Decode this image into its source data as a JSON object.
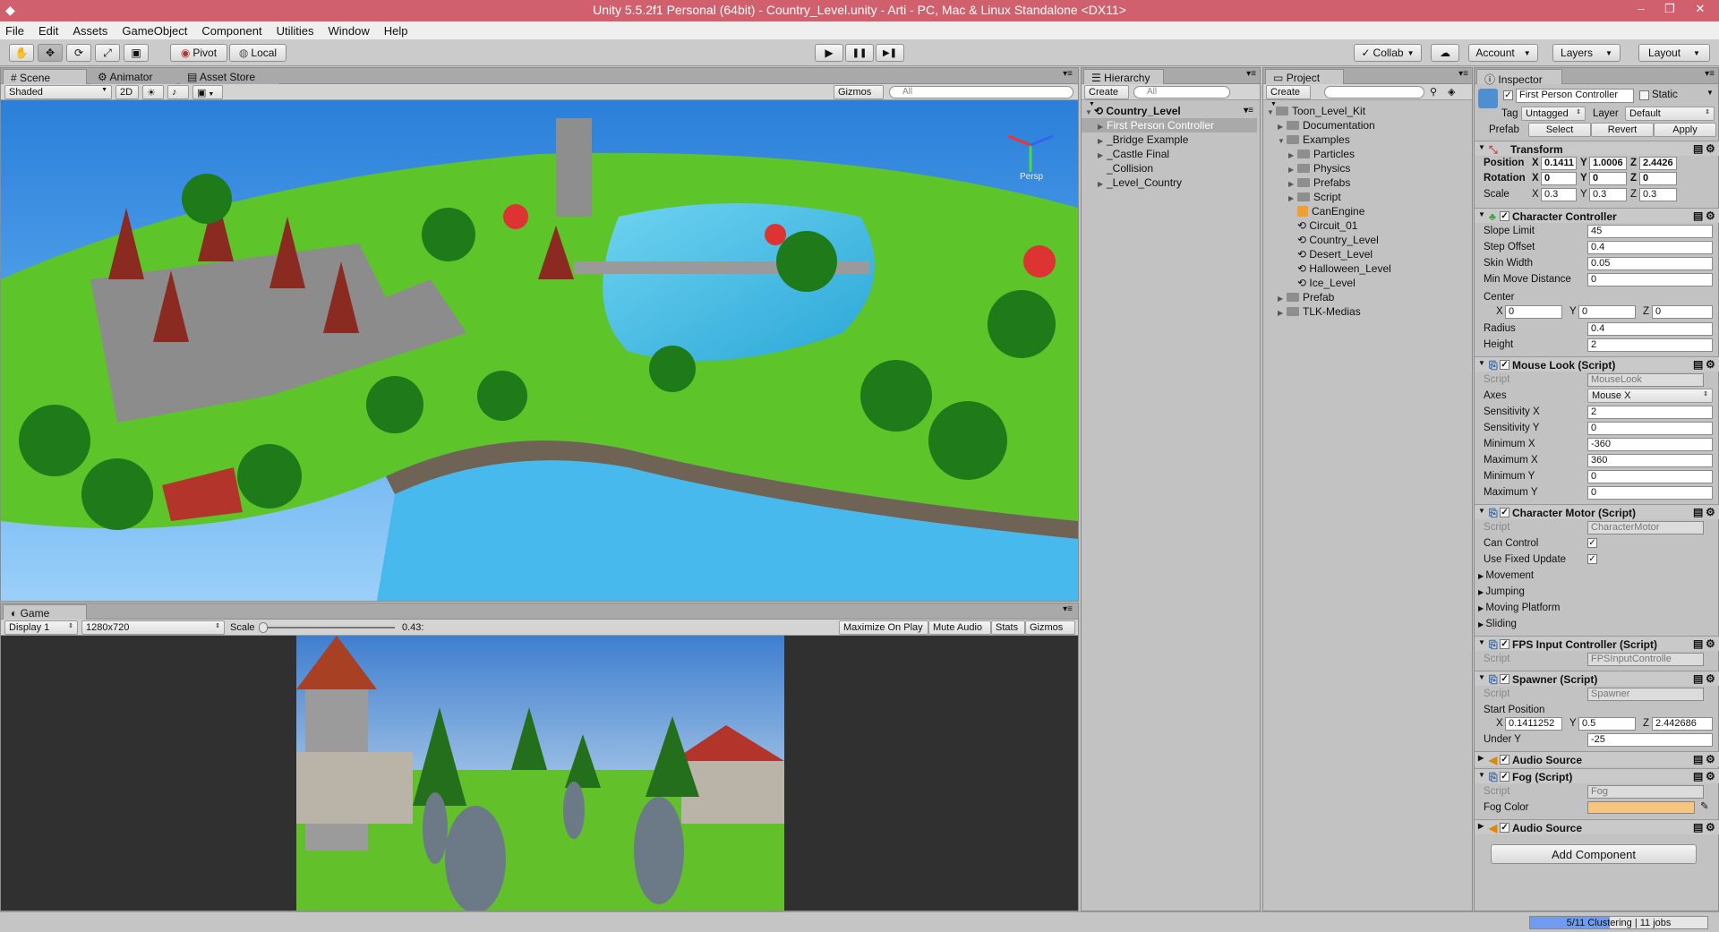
{
  "titlebar": {
    "title": "Unity 5.5.2f1 Personal (64bit) - Country_Level.unity - Arti - PC, Mac & Linux Standalone <DX11>",
    "min": "‒",
    "max": "❐",
    "close": "✕"
  },
  "menu": [
    "File",
    "Edit",
    "Assets",
    "GameObject",
    "Component",
    "Utilities",
    "Window",
    "Help"
  ],
  "toolbar": {
    "pivot": "Pivot",
    "local": "Local",
    "collab": "Collab",
    "account": "Account",
    "layers": "Layers",
    "layout": "Layout",
    "play": "▶",
    "pause": "❚❚",
    "step": "▶❚"
  },
  "scene": {
    "tabs": [
      "Scene",
      "Animator",
      "Asset Store"
    ],
    "shaded": "Shaded",
    "mode2d": "2D",
    "gizmos": "Gizmos",
    "search": "All",
    "persp": "Persp"
  },
  "game": {
    "tab": "Game",
    "display": "Display 1",
    "resolution": "1280x720",
    "scale_label": "Scale",
    "scale_value": "0.43:",
    "scale_fraction": 0.43,
    "buttons": [
      "Maximize On Play",
      "Mute Audio",
      "Stats",
      "Gizmos"
    ]
  },
  "hierarchy": {
    "tab": "Hierarchy",
    "create": "Create",
    "search": "All",
    "scene": "Country_Level",
    "items": [
      "First Person Controller",
      "_Bridge Example",
      "_Castle Final",
      "_Collision",
      "_Level_Country"
    ]
  },
  "project": {
    "tab": "Project",
    "create": "Create",
    "items": [
      {
        "label": "Toon_Level_Kit",
        "indent": 0,
        "type": "folder",
        "open": true
      },
      {
        "label": "Documentation",
        "indent": 1,
        "type": "folder"
      },
      {
        "label": "Examples",
        "indent": 1,
        "type": "folder",
        "open": true
      },
      {
        "label": "Particles",
        "indent": 2,
        "type": "folder"
      },
      {
        "label": "Physics",
        "indent": 2,
        "type": "folder"
      },
      {
        "label": "Prefabs",
        "indent": 2,
        "type": "folder"
      },
      {
        "label": "Script",
        "indent": 2,
        "type": "folder"
      },
      {
        "label": "CanEngine",
        "indent": 2,
        "type": "asset"
      },
      {
        "label": "Circuit_01",
        "indent": 2,
        "type": "scene"
      },
      {
        "label": "Country_Level",
        "indent": 2,
        "type": "scene"
      },
      {
        "label": "Desert_Level",
        "indent": 2,
        "type": "scene"
      },
      {
        "label": "Halloween_Level",
        "indent": 2,
        "type": "scene"
      },
      {
        "label": "Ice_Level",
        "indent": 2,
        "type": "scene"
      },
      {
        "label": "Prefab",
        "indent": 1,
        "type": "folder"
      },
      {
        "label": "TLK-Medias",
        "indent": 1,
        "type": "folder"
      }
    ]
  },
  "inspector": {
    "tab": "Inspector",
    "name": "First Person Controller",
    "static": "Static",
    "tag_label": "Tag",
    "tag": "Untagged",
    "layer_label": "Layer",
    "layer": "Default",
    "prefab_label": "Prefab",
    "prefab_buttons": [
      "Select",
      "Revert",
      "Apply"
    ],
    "transform": {
      "title": "Transform",
      "position": "Position",
      "rotation": "Rotation",
      "scale": "Scale",
      "pos": [
        "0.1411",
        "1.0006",
        "2.4426"
      ],
      "rot": [
        "0",
        "0",
        "0"
      ],
      "scl": [
        "0.3",
        "0.3",
        "0.3"
      ]
    },
    "cc": {
      "title": "Character Controller",
      "slope_label": "Slope Limit",
      "slope": "45",
      "step_label": "Step Offset",
      "step": "0.4",
      "skin_label": "Skin Width",
      "skin": "0.05",
      "minmove_label": "Min Move Distance",
      "minmove": "0",
      "center_label": "Center",
      "center": [
        "0",
        "0",
        "0"
      ],
      "radius_label": "Radius",
      "radius": "0.4",
      "height_label": "Height",
      "height": "2"
    },
    "mouselook": {
      "title": "Mouse Look (Script)",
      "script_label": "Script",
      "script": "MouseLook",
      "axes_label": "Axes",
      "axes": "Mouse X",
      "sx_label": "Sensitivity X",
      "sx": "2",
      "sy_label": "Sensitivity Y",
      "sy": "0",
      "minx_label": "Minimum X",
      "minx": "-360",
      "maxx_label": "Maximum X",
      "maxx": "360",
      "miny_label": "Minimum Y",
      "miny": "0",
      "maxy_label": "Maximum Y",
      "maxy": "0"
    },
    "motor": {
      "title": "Character Motor (Script)",
      "script_label": "Script",
      "script": "CharacterMotor",
      "can_control": "Can Control",
      "fixed_update": "Use Fixed Update",
      "sections": [
        "Movement",
        "Jumping",
        "Moving Platform",
        "Sliding"
      ]
    },
    "fps": {
      "title": "FPS Input Controller (Script)",
      "script_label": "Script",
      "script": "FPSInputControlle"
    },
    "spawner": {
      "title": "Spawner (Script)",
      "script_label": "Script",
      "script": "Spawner",
      "start_label": "Start Position",
      "start": [
        "0.1411252",
        "0.5",
        "2.442686"
      ],
      "under_label": "Under Y",
      "under": "-25"
    },
    "audio1": "Audio Source",
    "fog": {
      "title": "Fog (Script)",
      "script_label": "Script",
      "script": "Fog",
      "color_label": "Fog Color",
      "color": "#f6c681"
    },
    "audio2": "Audio Source",
    "add_component": "Add Component"
  },
  "status": {
    "progress": "5/11 Clustering | 11 jobs",
    "progress_fraction": 0.45
  }
}
